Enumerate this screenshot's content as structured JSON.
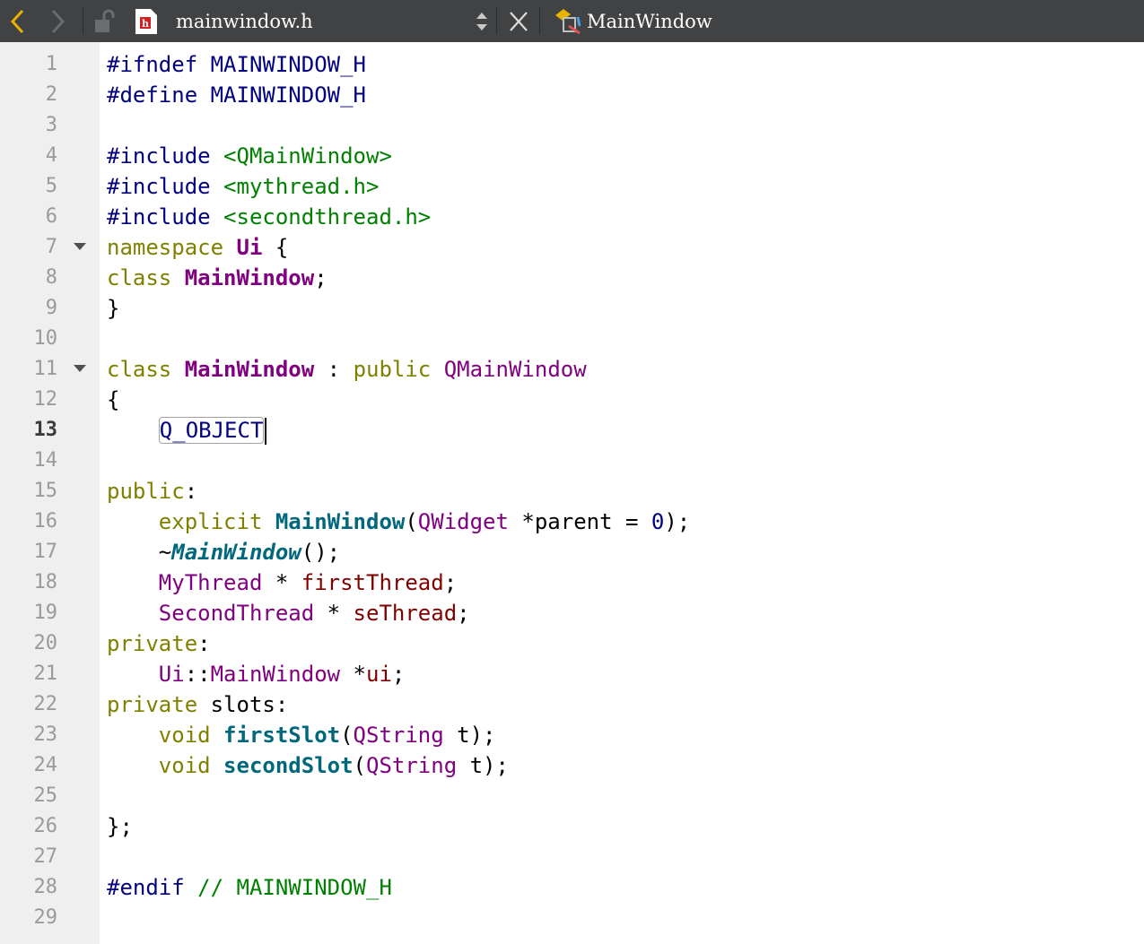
{
  "toolbar": {
    "file_name": "mainwindow.h",
    "symbol_name": "MainWindow",
    "icons": [
      "back-arrow-icon",
      "forward-arrow-icon",
      "lock-icon",
      "header-file-icon",
      "updown-arrows-icon",
      "close-icon",
      "class-symbol-icon"
    ],
    "accent_color": "#e8b400"
  },
  "editor": {
    "current_line": "13",
    "lines": [
      {
        "n": "1",
        "tokens": [
          {
            "c": "t-pre",
            "t": "#ifndef MAINWINDOW_H"
          }
        ]
      },
      {
        "n": "2",
        "tokens": [
          {
            "c": "t-pre",
            "t": "#define MAINWINDOW_H"
          }
        ]
      },
      {
        "n": "3",
        "tokens": []
      },
      {
        "n": "4",
        "tokens": [
          {
            "c": "t-pre",
            "t": "#include "
          },
          {
            "c": "t-str",
            "t": "<QMainWindow>"
          }
        ]
      },
      {
        "n": "5",
        "tokens": [
          {
            "c": "t-pre",
            "t": "#include "
          },
          {
            "c": "t-str",
            "t": "<mythread.h>"
          }
        ]
      },
      {
        "n": "6",
        "tokens": [
          {
            "c": "t-pre",
            "t": "#include "
          },
          {
            "c": "t-str",
            "t": "<secondthread.h>"
          }
        ]
      },
      {
        "n": "7",
        "fold": true,
        "tokens": [
          {
            "c": "t-kw",
            "t": "namespace"
          },
          {
            "c": "t-plain",
            "t": " "
          },
          {
            "c": "t-typeb",
            "t": "Ui"
          },
          {
            "c": "t-plain",
            "t": " {"
          }
        ]
      },
      {
        "n": "8",
        "tokens": [
          {
            "c": "t-kw",
            "t": "class"
          },
          {
            "c": "t-plain",
            "t": " "
          },
          {
            "c": "t-typeb",
            "t": "MainWindow"
          },
          {
            "c": "t-plain",
            "t": ";"
          }
        ]
      },
      {
        "n": "9",
        "tokens": [
          {
            "c": "t-plain",
            "t": "}"
          }
        ]
      },
      {
        "n": "10",
        "tokens": []
      },
      {
        "n": "11",
        "fold": true,
        "tokens": [
          {
            "c": "t-kw",
            "t": "class"
          },
          {
            "c": "t-plain",
            "t": " "
          },
          {
            "c": "t-typeb",
            "t": "MainWindow"
          },
          {
            "c": "t-plain",
            "t": " : "
          },
          {
            "c": "t-kw",
            "t": "public"
          },
          {
            "c": "t-plain",
            "t": " "
          },
          {
            "c": "t-type",
            "t": "QMainWindow"
          }
        ]
      },
      {
        "n": "12",
        "tokens": [
          {
            "c": "t-plain",
            "t": "{"
          }
        ]
      },
      {
        "n": "13",
        "tokens": [
          {
            "c": "t-plain",
            "t": "    "
          },
          {
            "c": "t-macro",
            "t": "Q_OBJECT"
          }
        ],
        "caret": true
      },
      {
        "n": "14",
        "tokens": []
      },
      {
        "n": "15",
        "tokens": [
          {
            "c": "t-kw",
            "t": "public"
          },
          {
            "c": "t-plain",
            "t": ":"
          }
        ]
      },
      {
        "n": "16",
        "tokens": [
          {
            "c": "t-plain",
            "t": "    "
          },
          {
            "c": "t-kw",
            "t": "explicit"
          },
          {
            "c": "t-plain",
            "t": " "
          },
          {
            "c": "t-func",
            "t": "MainWindow"
          },
          {
            "c": "t-plain",
            "t": "("
          },
          {
            "c": "t-type",
            "t": "QWidget"
          },
          {
            "c": "t-plain",
            "t": " *parent = "
          },
          {
            "c": "t-num",
            "t": "0"
          },
          {
            "c": "t-plain",
            "t": ");"
          }
        ]
      },
      {
        "n": "17",
        "tokens": [
          {
            "c": "t-plain",
            "t": "    ~"
          },
          {
            "c": "t-funci",
            "t": "MainWindow"
          },
          {
            "c": "t-plain",
            "t": "();"
          }
        ]
      },
      {
        "n": "18",
        "tokens": [
          {
            "c": "t-plain",
            "t": "    "
          },
          {
            "c": "t-type",
            "t": "MyThread"
          },
          {
            "c": "t-plain",
            "t": " * "
          },
          {
            "c": "t-field",
            "t": "firstThread"
          },
          {
            "c": "t-plain",
            "t": ";"
          }
        ]
      },
      {
        "n": "19",
        "tokens": [
          {
            "c": "t-plain",
            "t": "    "
          },
          {
            "c": "t-type",
            "t": "SecondThread"
          },
          {
            "c": "t-plain",
            "t": " * "
          },
          {
            "c": "t-field",
            "t": "seThread"
          },
          {
            "c": "t-plain",
            "t": ";"
          }
        ]
      },
      {
        "n": "20",
        "tokens": [
          {
            "c": "t-kw",
            "t": "private"
          },
          {
            "c": "t-plain",
            "t": ":"
          }
        ]
      },
      {
        "n": "21",
        "tokens": [
          {
            "c": "t-plain",
            "t": "    "
          },
          {
            "c": "t-type",
            "t": "Ui"
          },
          {
            "c": "t-plain",
            "t": "::"
          },
          {
            "c": "t-type",
            "t": "MainWindow"
          },
          {
            "c": "t-plain",
            "t": " *"
          },
          {
            "c": "t-field",
            "t": "ui"
          },
          {
            "c": "t-plain",
            "t": ";"
          }
        ]
      },
      {
        "n": "22",
        "tokens": [
          {
            "c": "t-kw",
            "t": "private"
          },
          {
            "c": "t-plain",
            "t": " slots:"
          }
        ]
      },
      {
        "n": "23",
        "tokens": [
          {
            "c": "t-plain",
            "t": "    "
          },
          {
            "c": "t-kw",
            "t": "void"
          },
          {
            "c": "t-plain",
            "t": " "
          },
          {
            "c": "t-func",
            "t": "firstSlot"
          },
          {
            "c": "t-plain",
            "t": "("
          },
          {
            "c": "t-type",
            "t": "QString"
          },
          {
            "c": "t-plain",
            "t": " t);"
          }
        ]
      },
      {
        "n": "24",
        "tokens": [
          {
            "c": "t-plain",
            "t": "    "
          },
          {
            "c": "t-kw",
            "t": "void"
          },
          {
            "c": "t-plain",
            "t": " "
          },
          {
            "c": "t-func",
            "t": "secondSlot"
          },
          {
            "c": "t-plain",
            "t": "("
          },
          {
            "c": "t-type",
            "t": "QString"
          },
          {
            "c": "t-plain",
            "t": " t);"
          }
        ]
      },
      {
        "n": "25",
        "tokens": []
      },
      {
        "n": "26",
        "tokens": [
          {
            "c": "t-plain",
            "t": "};"
          }
        ]
      },
      {
        "n": "27",
        "tokens": []
      },
      {
        "n": "28",
        "tokens": [
          {
            "c": "t-pre",
            "t": "#endif"
          },
          {
            "c": "t-plain",
            "t": " "
          },
          {
            "c": "t-com",
            "t": "// MAINWINDOW_H"
          }
        ]
      },
      {
        "n": "29",
        "tokens": []
      }
    ]
  }
}
